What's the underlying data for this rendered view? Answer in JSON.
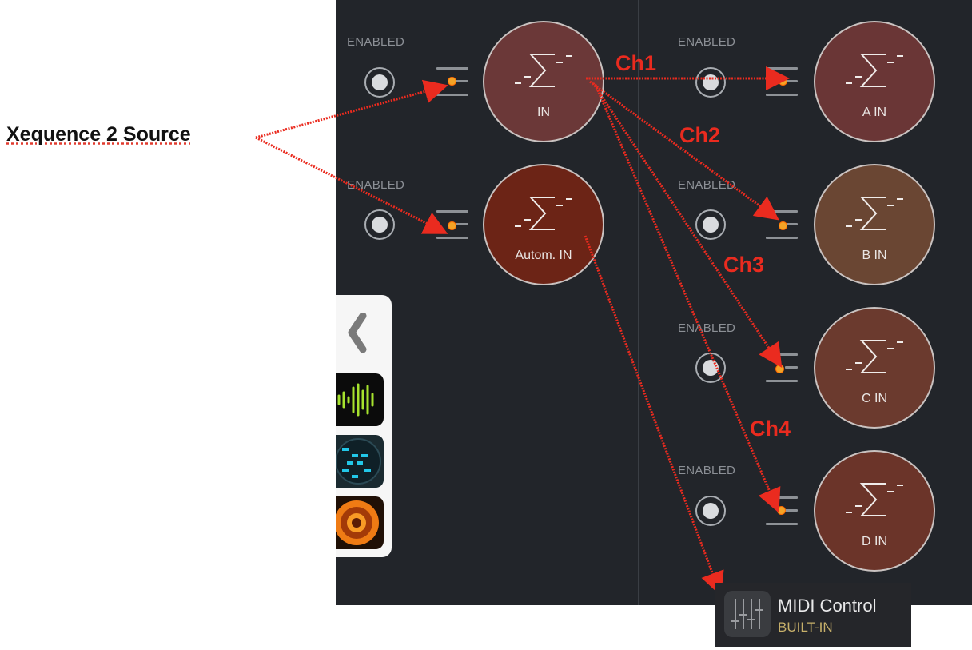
{
  "annotation": {
    "source_label": "Xequence 2 Source",
    "channels": [
      "Ch1",
      "Ch2",
      "Ch3",
      "Ch4"
    ]
  },
  "left_column": {
    "rows": [
      {
        "enabled_label": "ENABLED",
        "node_label": "IN",
        "node_color": "#6b3838"
      },
      {
        "enabled_label": "ENABLED",
        "node_label": "Autom. IN",
        "node_color": "#6c2416"
      }
    ]
  },
  "right_column": {
    "rows": [
      {
        "enabled_label": "ENABLED",
        "node_label": "A IN",
        "node_color": "#6a3636"
      },
      {
        "enabled_label": "ENABLED",
        "node_label": "B IN",
        "node_color": "#6a4633"
      },
      {
        "enabled_label": "ENABLED",
        "node_label": "C IN",
        "node_color": "#6b3a2e"
      },
      {
        "enabled_label": "ENABLED",
        "node_label": "D IN",
        "node_color": "#6b3429"
      }
    ]
  },
  "sidebar": {
    "apps": [
      "audio-waveform-app-icon",
      "grid-sequencer-app-icon",
      "orange-disc-app-icon"
    ]
  },
  "midi_control": {
    "title": "MIDI Control",
    "subtitle": "BUILT-IN"
  },
  "colors": {
    "annotation_red": "#ea2b1f",
    "port_orange": "#f4a326",
    "panel_bg": "#22252a"
  }
}
